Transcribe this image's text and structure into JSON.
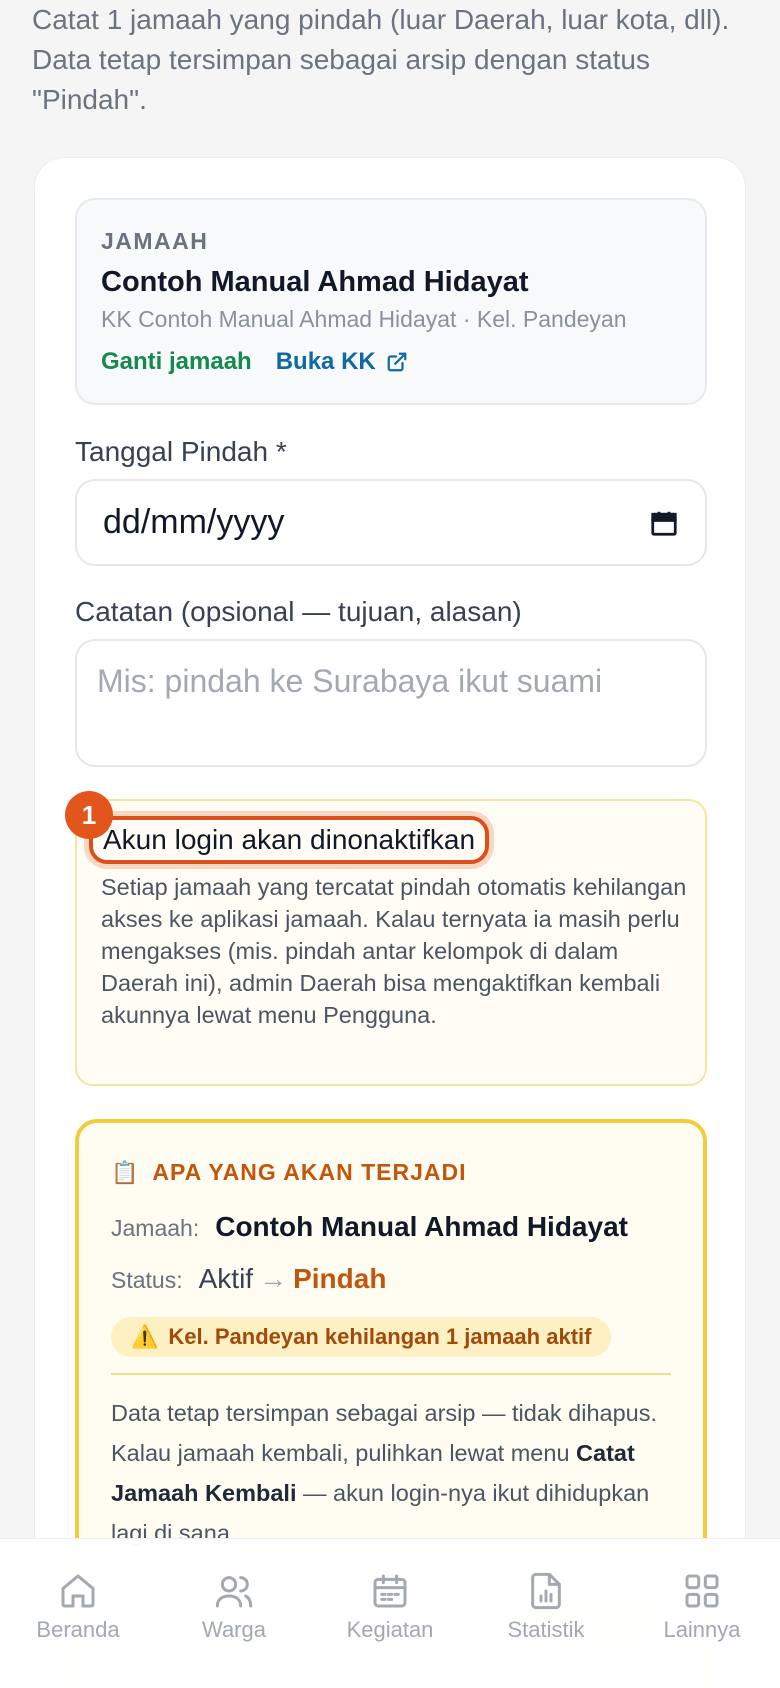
{
  "intro": {
    "line1": "Catat 1 jamaah yang pindah (luar Daerah, luar kota, dll).",
    "line2": "Data tetap tersimpan sebagai arsip dengan status",
    "line3": "\"Pindah\"."
  },
  "jamaah": {
    "label": "JAMAAH",
    "name": "Contoh Manual Ahmad Hidayat",
    "sub": "KK Contoh Manual Ahmad Hidayat · Kel. Pandeyan",
    "ganti_label": "Ganti jamaah",
    "buka_kk_label": "Buka KK"
  },
  "form": {
    "tanggal_label": "Tanggal Pindah *",
    "tanggal_value": "dd/mm/yyyy",
    "catatan_label": "Catatan (opsional — tujuan, alasan)",
    "catatan_placeholder": "Mis: pindah ke Surabaya ikut suami"
  },
  "warning": {
    "badge": "1",
    "title": "Akun login akan dinonaktifkan",
    "body": "Setiap jamaah yang tercatat pindah otomatis kehilangan akses ke aplikasi jamaah. Kalau ternyata ia masih perlu mengakses (mis. pindah antar kelompok di dalam Daerah ini), admin Daerah bisa mengaktifkan kembali akunnya lewat menu Pengguna."
  },
  "result": {
    "icon": "📋",
    "title": "APA YANG AKAN TERJADI",
    "jamaah_key": "Jamaah:",
    "jamaah_value": "Contoh Manual Ahmad Hidayat",
    "status_key": "Status:",
    "status_from": "Aktif",
    "status_arrow": "→",
    "status_to": "Pindah",
    "pill_icon": "⚠️",
    "pill_text": "Kel. Pandeyan kehilangan 1 jamaah aktif",
    "body_part1": "Data tetap tersimpan sebagai arsip — tidak dihapus. Kalau jamaah kembali, pulihkan lewat menu ",
    "body_bold": "Catat Jamaah Kembali",
    "body_part2": " — akun login-nya ikut dihidupkan lagi di sana."
  },
  "nav": [
    {
      "label": "Beranda",
      "icon": "home-icon"
    },
    {
      "label": "Warga",
      "icon": "users-icon"
    },
    {
      "label": "Kegiatan",
      "icon": "calendar-icon"
    },
    {
      "label": "Statistik",
      "icon": "chart-file-icon"
    },
    {
      "label": "Lainnya",
      "icon": "grid-icon"
    }
  ],
  "colors": {
    "accent_orange": "#c2560c",
    "highlight_orange": "#d9501a",
    "link_green": "#15894f",
    "link_blue": "#0f6aa0",
    "warning_border": "#f2cc3c"
  }
}
